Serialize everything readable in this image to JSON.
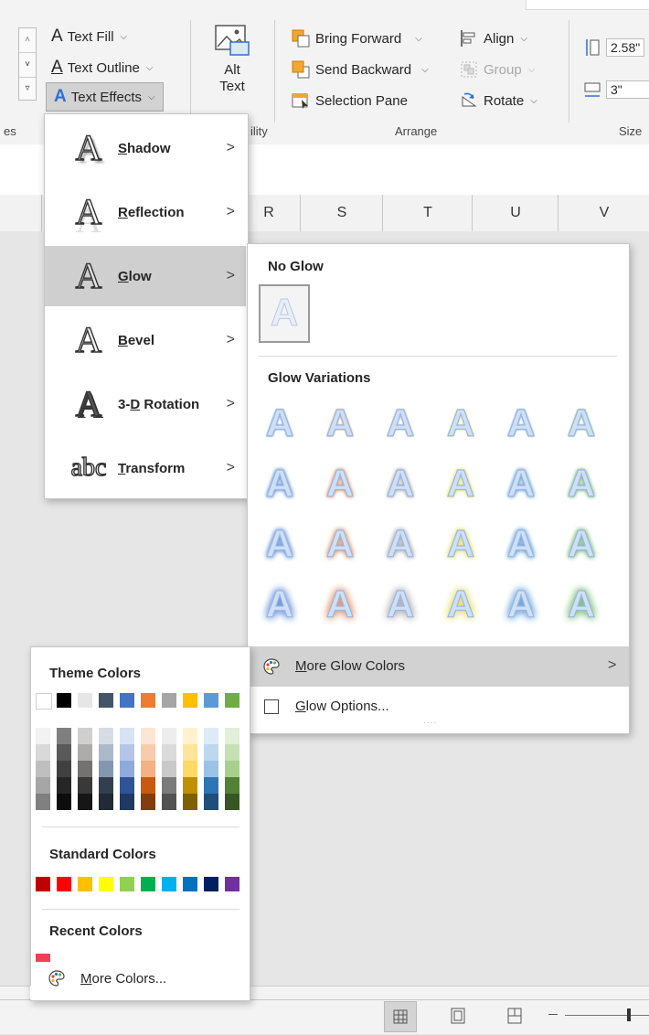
{
  "ribbon": {
    "text_fill": "Text Fill",
    "text_outline": "Text Outline",
    "text_effects": "Text Effects",
    "alt_text_line1": "Alt",
    "alt_text_line2": "Text",
    "bring_forward": "Bring Forward",
    "send_backward": "Send Backward",
    "selection_pane": "Selection Pane",
    "align": "Align",
    "group": "Group",
    "rotate": "Rotate",
    "height_value": "2.58\"",
    "width_value": "3\"",
    "group_label_left": "es",
    "group_label_accessibility": "ility",
    "group_label_arrange": "Arrange",
    "group_label_size": "Size"
  },
  "columns": [
    "R",
    "S",
    "T",
    "U",
    "V"
  ],
  "effects_menu": [
    {
      "label": "Shadow",
      "icon": "shadow-a-icon",
      "glyph": "A",
      "access_key": "S",
      "pre": "",
      "post": "hadow"
    },
    {
      "label": "Reflection",
      "icon": "reflection-a-icon",
      "glyph": "A",
      "access_key": "R",
      "pre": "",
      "post": "eflection"
    },
    {
      "label": "Glow",
      "icon": "glow-a-icon",
      "glyph": "A",
      "access_key": "G",
      "pre": "",
      "post": "low"
    },
    {
      "label": "Bevel",
      "icon": "bevel-a-icon",
      "glyph": "A",
      "access_key": "B",
      "pre": "",
      "post": "evel"
    },
    {
      "label": "3-D Rotation",
      "icon": "rotation-3d-a-icon",
      "glyph": "A",
      "access_key": "D",
      "pre": "3-",
      "post": " Rotation"
    },
    {
      "label": "Transform",
      "icon": "transform-abc-icon",
      "glyph": "abc",
      "access_key": "T",
      "pre": "",
      "post": "ransform"
    }
  ],
  "submenu_arrow": ">",
  "glow_panel": {
    "no_glow_title": "No Glow",
    "variations_title": "Glow Variations",
    "glyph": "A",
    "variation_colors": [
      "#5b8ad6",
      "#e08a5a",
      "#a9a9a9",
      "#e8dc5a",
      "#5b9bd5",
      "#70b96a"
    ],
    "more_glow_colors": "More Glow Colors",
    "more_glow_colors_key": "M",
    "more_glow_colors_rest": "ore Glow Colors",
    "glow_options": "Glow Options...",
    "glow_options_key": "G",
    "glow_options_rest": "low Options...",
    "more_arrow": ">",
    "grip": "...."
  },
  "color_panel": {
    "theme_title": "Theme Colors",
    "theme_colors": [
      "#ffffff",
      "#000000",
      "#e7e6e6",
      "#44546a",
      "#4472c4",
      "#ed7d31",
      "#a5a5a5",
      "#ffc000",
      "#5b9bd5",
      "#70ad47"
    ],
    "theme_shades": [
      [
        "#f2f2f2",
        "#d9d9d9",
        "#bfbfbf",
        "#a6a6a6",
        "#808080"
      ],
      [
        "#7f7f7f",
        "#595959",
        "#404040",
        "#262626",
        "#0d0d0d"
      ],
      [
        "#d0cece",
        "#aeabab",
        "#757171",
        "#3a3838",
        "#171616"
      ],
      [
        "#d6dce4",
        "#adb9ca",
        "#8497b0",
        "#333f4f",
        "#222a35"
      ],
      [
        "#d9e2f3",
        "#b4c6e7",
        "#8eaadb",
        "#2f5496",
        "#1f3864"
      ],
      [
        "#fbe5d5",
        "#f7cbac",
        "#f4b183",
        "#c55a11",
        "#833c0b"
      ],
      [
        "#ededed",
        "#dbdbdb",
        "#c9c9c9",
        "#7b7b7b",
        "#525252"
      ],
      [
        "#fff2cc",
        "#ffe599",
        "#ffd966",
        "#bf9000",
        "#7f6000"
      ],
      [
        "#deebf6",
        "#bdd7ee",
        "#9cc3e5",
        "#2e75b5",
        "#1e4e79"
      ],
      [
        "#e2efd9",
        "#c5e0b3",
        "#a8d08d",
        "#538135",
        "#375623"
      ]
    ],
    "standard_title": "Standard Colors",
    "standard_colors": [
      "#c00000",
      "#ff0000",
      "#ffc000",
      "#ffff00",
      "#92d050",
      "#00b050",
      "#00b0f0",
      "#0070c0",
      "#002060",
      "#7030a0"
    ],
    "recent_title": "Recent Colors",
    "recent_colors": [
      "#ef4056"
    ],
    "more_colors_key": "M",
    "more_colors_rest": "ore Colors..."
  }
}
